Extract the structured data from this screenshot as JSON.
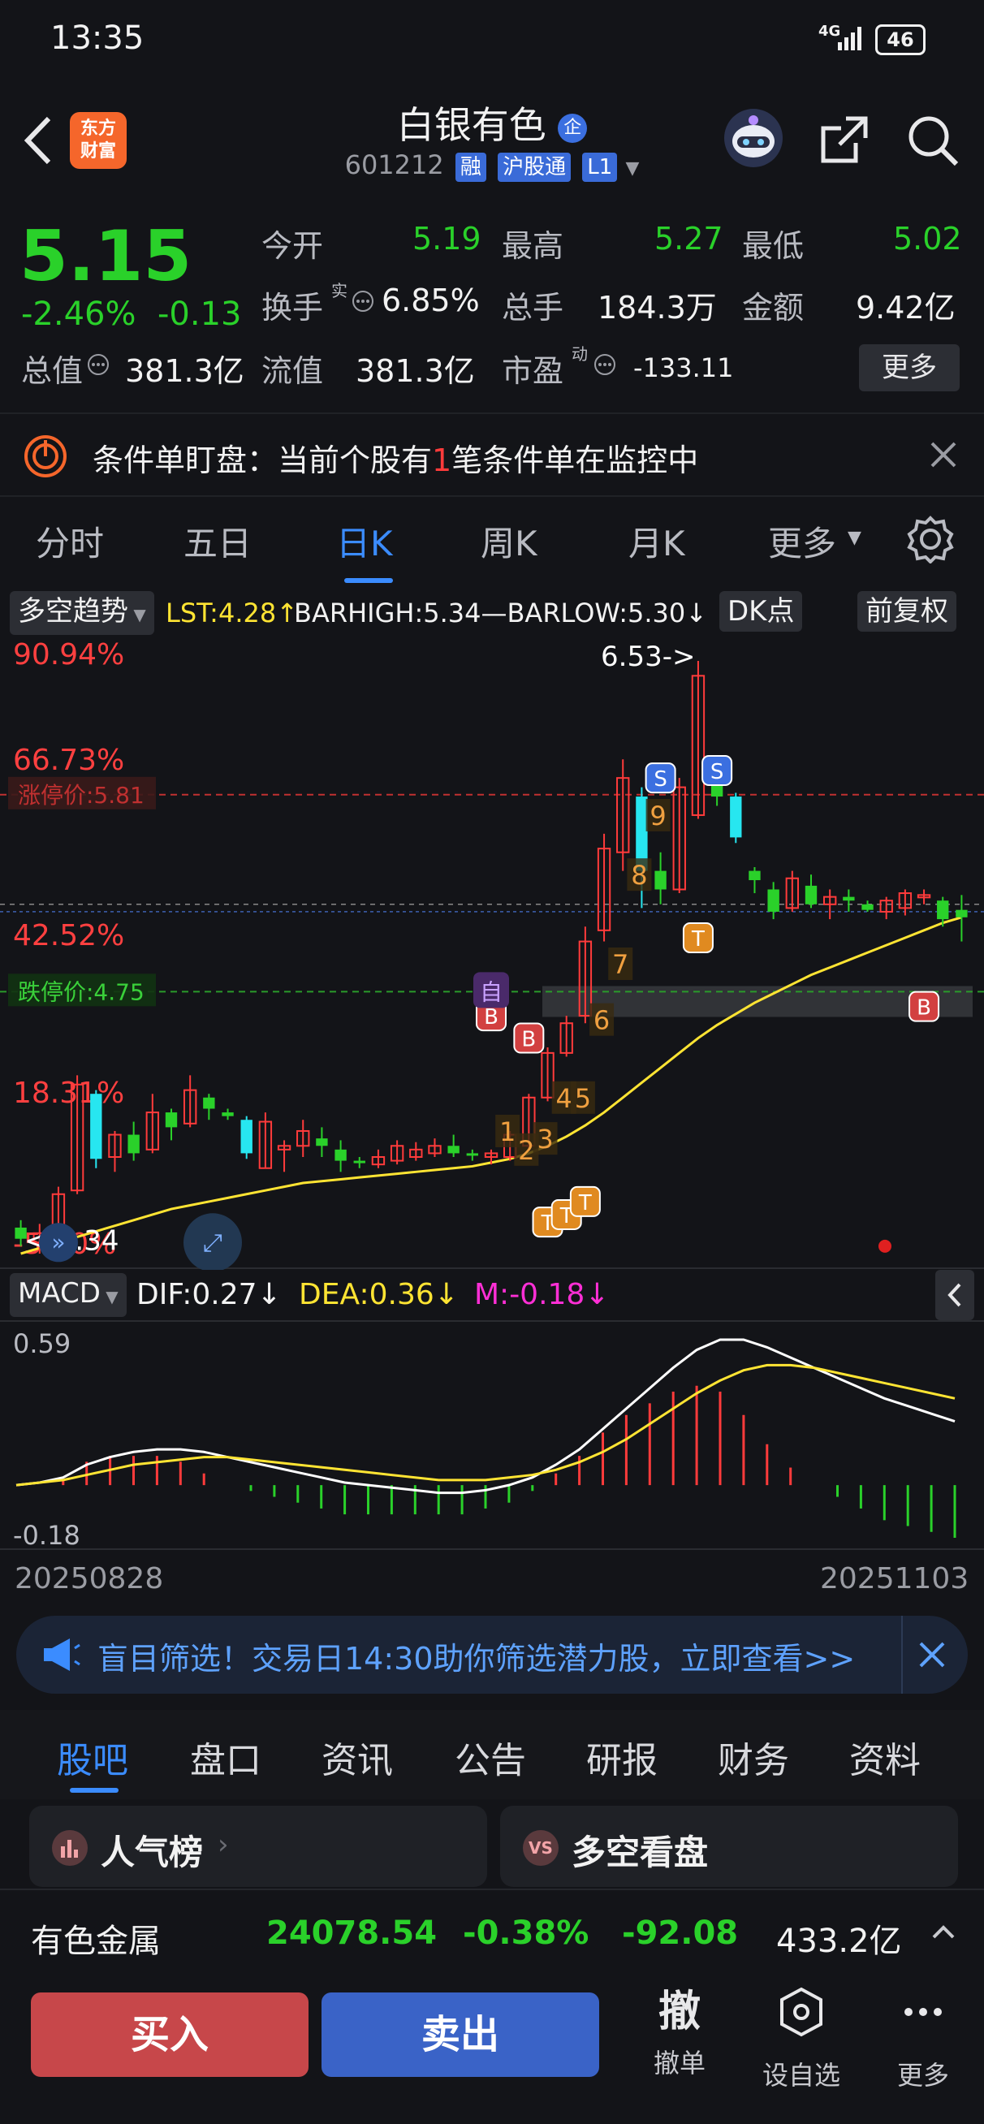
{
  "status_bar": {
    "time": "13:35",
    "network": "4G",
    "battery": "46"
  },
  "header": {
    "logo_text_line1": "东方",
    "logo_text_line2": "财富",
    "stock_name": "白银有色",
    "badge": "企",
    "stock_code": "601212",
    "tags": [
      "融",
      "沪股通",
      "L1"
    ]
  },
  "quote": {
    "price": "5.15",
    "change_pct": "-2.46%",
    "change": "-0.13",
    "open_label": "今开",
    "open": "5.19",
    "high_label": "最高",
    "high": "5.27",
    "low_label": "最低",
    "low": "5.02",
    "turnover_label": "换手",
    "turnover_sup": "实",
    "turnover": "6.85%",
    "volume_label": "总手",
    "volume": "184.3万",
    "amount_label": "金额",
    "amount": "9.42亿",
    "mktcap_label": "总值",
    "mktcap": "381.3亿",
    "float_label": "流值",
    "float": "381.3亿",
    "pe_label": "市盈",
    "pe_sup": "动",
    "pe": "-133.11",
    "more_label": "更多"
  },
  "notice": {
    "prefix": "条件单盯盘：当前个股有",
    "count": "1",
    "suffix": "笔条件单在监控中"
  },
  "chart_tabs": [
    "分时",
    "五日",
    "日K",
    "周K",
    "月K",
    "更多"
  ],
  "chart_tabs_active": 2,
  "indicator_bar": {
    "strategy": "多空趋势",
    "lst": "LST:4.28↑",
    "barhigh": "BARHIGH:5.34—BARLOW:5.30↓",
    "dk_button": "DK点",
    "adjust_button": "前复权"
  },
  "kchart": {
    "pct_labels": [
      "90.94%",
      "66.73%",
      "42.52%",
      "18.31%",
      "-5.90%"
    ],
    "limit_up_label": "涨停价:5.81",
    "limit_down_label": "跌停价:4.75",
    "high_annotation": "6.53->",
    "low_annotation": "<-3.34",
    "marker_zi": "自",
    "wave_numbers": [
      "1",
      "2",
      "3",
      "4",
      "5",
      "6",
      "7",
      "8",
      "9"
    ]
  },
  "macd": {
    "name": "MACD",
    "dif": "DIF:0.27↓",
    "dea": "DEA:0.36↓",
    "m": "M:-0.18↓",
    "top_label": "0.59",
    "bottom_label": "-0.18"
  },
  "date_range": {
    "start": "20250828",
    "end": "20251103"
  },
  "banner": {
    "text": "盲目筛选！交易日14:30助你筛选潜力股，立即查看>>"
  },
  "bottom_tabs": [
    "股吧",
    "盘口",
    "资讯",
    "公告",
    "研报",
    "财务",
    "资料"
  ],
  "bottom_tabs_active": 0,
  "cards": [
    {
      "label": "人气榜",
      "icon": "bar-chart-icon"
    },
    {
      "label": "多空看盘",
      "icon": "vs-icon"
    }
  ],
  "index_bar": {
    "name": "有色金属",
    "value": "24078.54",
    "pct": "-0.38%",
    "change": "-92.08",
    "amount": "433.2亿"
  },
  "actions": {
    "buy": "买入",
    "sell": "卖出",
    "cancel_glyph": "撤",
    "cancel": "撤单",
    "set_watch": "设自选",
    "more": "更多"
  },
  "colors": {
    "up": "#ff3b3b",
    "down": "#2ad12a",
    "cyan": "#27e6f0",
    "accent": "#3b8cff",
    "ma": "#ffe433"
  },
  "chart_data": [
    {
      "type": "candlestick",
      "title": "日K",
      "x_range": [
        "20250828",
        "20251103"
      ],
      "ylim": [
        3.34,
        6.53
      ],
      "annotations": [
        "6.53->",
        "<-3.34",
        "涨停价:5.81",
        "跌停价:4.75"
      ],
      "series": [
        {
          "name": "K",
          "ohlc": [
            [
              3.48,
              3.52,
              3.38,
              3.42
            ],
            [
              3.4,
              3.5,
              3.34,
              3.45
            ],
            [
              3.45,
              3.7,
              3.44,
              3.66
            ],
            [
              3.68,
              4.3,
              3.66,
              4.25
            ],
            [
              4.2,
              4.22,
              3.8,
              3.85
            ],
            [
              3.86,
              4.0,
              3.78,
              3.98
            ],
            [
              3.98,
              4.05,
              3.84,
              3.88
            ],
            [
              3.9,
              4.2,
              3.88,
              4.1
            ],
            [
              4.1,
              4.12,
              3.95,
              4.02
            ],
            [
              4.04,
              4.3,
              4.02,
              4.22
            ],
            [
              4.18,
              4.2,
              4.06,
              4.12
            ],
            [
              4.1,
              4.12,
              4.06,
              4.08
            ],
            [
              4.06,
              4.08,
              3.85,
              3.88
            ],
            [
              3.8,
              4.1,
              3.8,
              4.05
            ],
            [
              3.9,
              3.95,
              3.78,
              3.92
            ],
            [
              3.92,
              4.06,
              3.86,
              4.0
            ],
            [
              3.96,
              4.02,
              3.86,
              3.92
            ],
            [
              3.9,
              3.95,
              3.78,
              3.84
            ],
            [
              3.84,
              3.86,
              3.8,
              3.83
            ],
            [
              3.82,
              3.9,
              3.8,
              3.86
            ],
            [
              3.84,
              3.95,
              3.82,
              3.92
            ],
            [
              3.86,
              3.94,
              3.84,
              3.9
            ],
            [
              3.88,
              3.96,
              3.86,
              3.92
            ],
            [
              3.92,
              3.98,
              3.86,
              3.88
            ],
            [
              3.88,
              3.9,
              3.84,
              3.87
            ],
            [
              3.86,
              3.9,
              3.82,
              3.88
            ],
            [
              3.86,
              4.0,
              3.84,
              3.98
            ],
            [
              3.92,
              4.2,
              3.9,
              4.18
            ],
            [
              4.18,
              4.45,
              4.16,
              4.42
            ],
            [
              4.42,
              4.62,
              4.4,
              4.58
            ],
            [
              4.62,
              5.1,
              4.58,
              5.02
            ],
            [
              5.08,
              5.6,
              5.02,
              5.52
            ],
            [
              5.5,
              6.0,
              5.4,
              5.9
            ],
            [
              5.8,
              5.85,
              5.2,
              5.4
            ],
            [
              5.4,
              5.5,
              5.22,
              5.3
            ],
            [
              5.3,
              5.9,
              5.28,
              5.85
            ],
            [
              5.7,
              6.53,
              5.68,
              6.45
            ],
            [
              5.9,
              5.95,
              5.75,
              5.8
            ],
            [
              5.8,
              5.82,
              5.55,
              5.58
            ],
            [
              5.4,
              5.42,
              5.28,
              5.35
            ],
            [
              5.3,
              5.34,
              5.14,
              5.18
            ],
            [
              5.2,
              5.4,
              5.18,
              5.36
            ],
            [
              5.32,
              5.38,
              5.2,
              5.22
            ],
            [
              5.22,
              5.3,
              5.14,
              5.26
            ],
            [
              5.26,
              5.3,
              5.18,
              5.24
            ],
            [
              5.22,
              5.24,
              5.18,
              5.19
            ],
            [
              5.18,
              5.26,
              5.14,
              5.24
            ],
            [
              5.2,
              5.3,
              5.16,
              5.28
            ],
            [
              5.26,
              5.3,
              5.22,
              5.27
            ],
            [
              5.24,
              5.26,
              5.1,
              5.14
            ],
            [
              5.19,
              5.27,
              5.02,
              5.15
            ]
          ]
        },
        {
          "name": "MA",
          "values": [
            3.34,
            3.37,
            3.4,
            3.43,
            3.46,
            3.49,
            3.52,
            3.55,
            3.58,
            3.6,
            3.62,
            3.64,
            3.66,
            3.68,
            3.7,
            3.72,
            3.73,
            3.74,
            3.75,
            3.76,
            3.77,
            3.78,
            3.79,
            3.8,
            3.81,
            3.83,
            3.85,
            3.88,
            3.92,
            3.97,
            4.03,
            4.1,
            4.18,
            4.26,
            4.34,
            4.42,
            4.5,
            4.57,
            4.63,
            4.69,
            4.74,
            4.79,
            4.84,
            4.88,
            4.92,
            4.96,
            5.0,
            5.04,
            5.08,
            5.12,
            5.15
          ]
        }
      ]
    },
    {
      "type": "bar",
      "title": "MACD",
      "ylim": [
        -0.18,
        0.59
      ],
      "series": [
        {
          "name": "DIF",
          "values": [
            0.02,
            0.03,
            0.05,
            0.1,
            0.13,
            0.15,
            0.16,
            0.16,
            0.15,
            0.13,
            0.11,
            0.09,
            0.07,
            0.05,
            0.03,
            0.02,
            0.01,
            0.0,
            -0.01,
            -0.01,
            0.0,
            0.02,
            0.05,
            0.1,
            0.16,
            0.24,
            0.32,
            0.4,
            0.48,
            0.55,
            0.59,
            0.59,
            0.56,
            0.52,
            0.48,
            0.44,
            0.4,
            0.36,
            0.33,
            0.3,
            0.27
          ]
        },
        {
          "name": "DEA",
          "values": [
            0.02,
            0.03,
            0.04,
            0.06,
            0.08,
            0.1,
            0.11,
            0.12,
            0.13,
            0.13,
            0.12,
            0.11,
            0.1,
            0.09,
            0.08,
            0.07,
            0.06,
            0.05,
            0.04,
            0.04,
            0.04,
            0.05,
            0.06,
            0.08,
            0.11,
            0.15,
            0.2,
            0.26,
            0.32,
            0.38,
            0.43,
            0.47,
            0.49,
            0.49,
            0.48,
            0.46,
            0.44,
            0.42,
            0.4,
            0.38,
            0.36
          ]
        }
      ]
    }
  ]
}
